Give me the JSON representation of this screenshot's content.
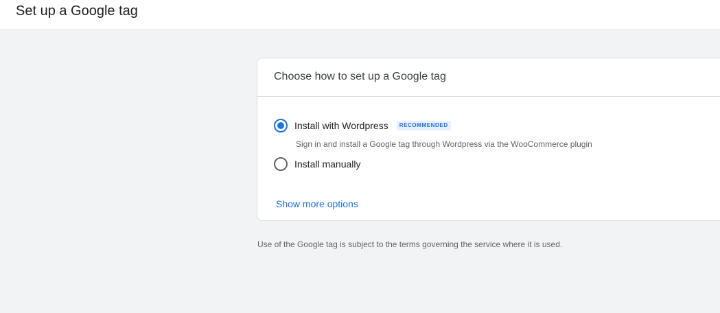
{
  "header": {
    "title": "Set up a Google tag"
  },
  "card": {
    "title": "Choose how to set up a Google tag",
    "options": [
      {
        "label": "Install with Wordpress",
        "badge": "RECOMMENDED",
        "description": "Sign in and install a Google tag through Wordpress via the WooCommerce plugin",
        "selected": true
      },
      {
        "label": "Install manually",
        "selected": false
      }
    ],
    "more_link": "Show more options"
  },
  "footer": {
    "note": "Use of the Google tag is subject to the terms governing the service where it is used."
  },
  "colors": {
    "accent": "#1a73e8",
    "background": "#f1f3f4"
  }
}
